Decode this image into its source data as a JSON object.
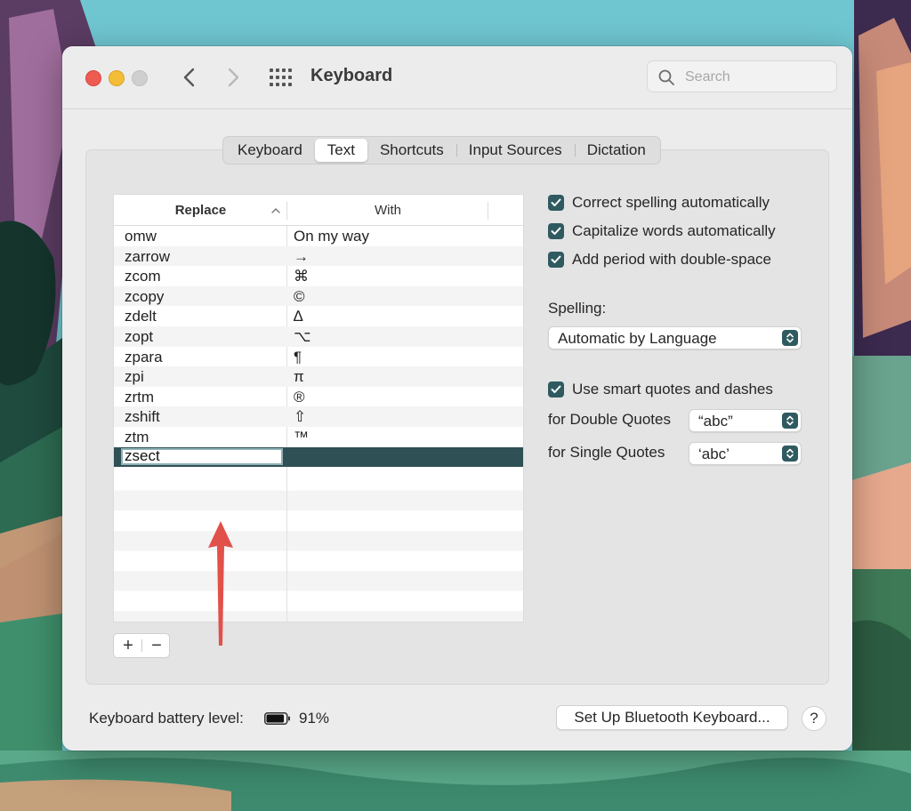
{
  "window": {
    "title": "Keyboard",
    "search_placeholder": "Search"
  },
  "tabs": [
    {
      "label": "Keyboard",
      "active": false
    },
    {
      "label": "Text",
      "active": true
    },
    {
      "label": "Shortcuts",
      "active": false
    },
    {
      "label": "Input Sources",
      "active": false
    },
    {
      "label": "Dictation",
      "active": false
    }
  ],
  "table": {
    "headers": {
      "replace": "Replace",
      "with": "With"
    },
    "rows": [
      {
        "replace": "omw",
        "with": "On my way"
      },
      {
        "replace": "zarrow",
        "with": "→"
      },
      {
        "replace": "zcom",
        "with": "⌘"
      },
      {
        "replace": "zcopy",
        "with": "©"
      },
      {
        "replace": "zdelt",
        "with": "∆"
      },
      {
        "replace": "zopt",
        "with": "⌥"
      },
      {
        "replace": "zpara",
        "with": "¶"
      },
      {
        "replace": "zpi",
        "with": "π"
      },
      {
        "replace": "zrtm",
        "with": "®"
      },
      {
        "replace": "zshift",
        "with": "⇧"
      },
      {
        "replace": "ztm",
        "with": "™"
      }
    ],
    "editing_row": {
      "replace": "zsect",
      "with": ""
    },
    "add_label": "+",
    "remove_label": "−"
  },
  "options": {
    "correct_spelling": {
      "label": "Correct spelling automatically",
      "checked": true
    },
    "capitalize_words": {
      "label": "Capitalize words automatically",
      "checked": true
    },
    "add_period": {
      "label": "Add period with double-space",
      "checked": true
    },
    "spelling_label": "Spelling:",
    "spelling_value": "Automatic by Language",
    "smart_quotes": {
      "label": "Use smart quotes and dashes",
      "checked": true
    },
    "double_quotes_label": "for Double Quotes",
    "double_quotes_value": "“abc”",
    "single_quotes_label": "for Single Quotes",
    "single_quotes_value": "‘abc’"
  },
  "footer": {
    "battery_label": "Keyboard battery level:",
    "battery_percent": "91%",
    "battery_level": 0.91,
    "bluetooth_button": "Set Up Bluetooth Keyboard...",
    "help_button": "?"
  },
  "colors": {
    "accent": "#2f5a60",
    "selected_row": "#2f5055",
    "annotation_arrow": "#e2504a"
  }
}
